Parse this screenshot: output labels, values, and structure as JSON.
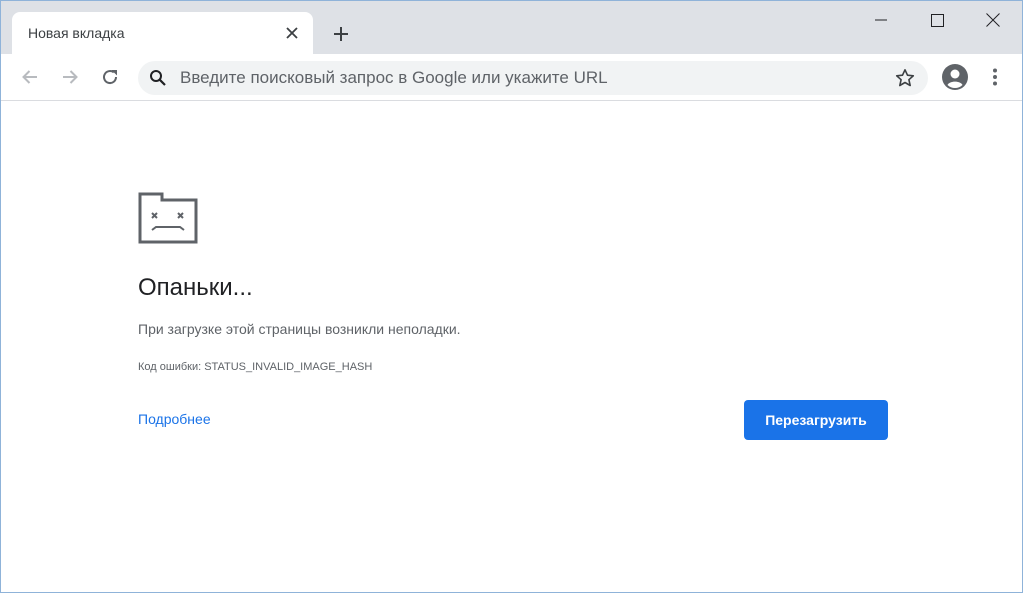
{
  "browser": {
    "tab": {
      "title": "Новая вкладка"
    },
    "omnibox": {
      "placeholder": "Введите поисковый запрос в Google или укажите URL",
      "value": ""
    }
  },
  "icons": {
    "close_tab": "close-icon",
    "new_tab": "plus-icon",
    "minimize": "minimize-icon",
    "maximize": "maximize-icon",
    "close_window": "close-icon",
    "back": "arrow-left-icon",
    "forward": "arrow-right-icon",
    "reload": "reload-icon",
    "search": "search-icon",
    "bookmark": "star-icon",
    "profile": "account-icon",
    "menu": "kebab-menu-icon",
    "error": "sad-tab-icon"
  },
  "error_page": {
    "heading": "Опаньки...",
    "description": "При загрузке этой страницы возникли неполадки.",
    "error_code": "Код ошибки: STATUS_INVALID_IMAGE_HASH",
    "details_link": "Подробнее",
    "reload_button": "Перезагрузить"
  },
  "colors": {
    "tabstrip_bg": "#dee1e6",
    "accent": "#1a73e8",
    "text_primary": "#202124",
    "text_secondary": "#5f6368"
  }
}
